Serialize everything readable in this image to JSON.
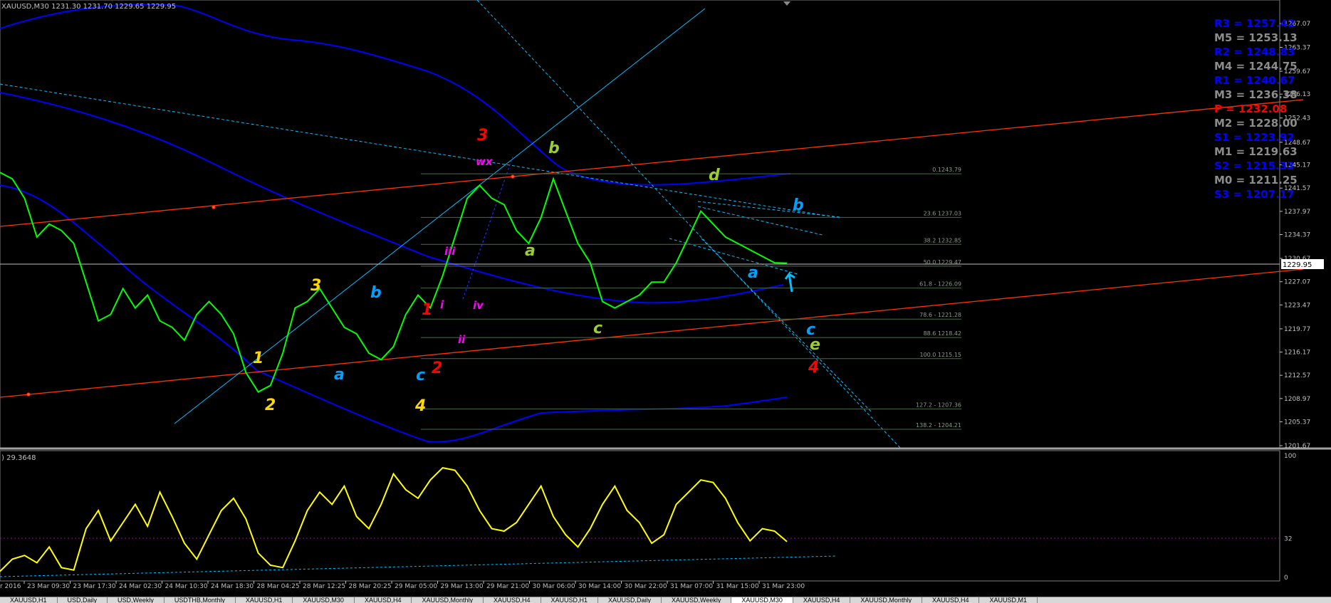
{
  "window": {
    "title": "XAUUSD,M30",
    "ohlc": "1231.30 1231.70 1229.65 1229.95"
  },
  "chart_data": {
    "type": "line",
    "title": "XAUUSD,M30 1231.30 1231.70 1229.65 1229.95",
    "price_scale": {
      "ticks": [
        "1267.07",
        "1263.37",
        "1259.67",
        "1256.13",
        "1252.43",
        "1248.67",
        "1245.17",
        "1241.57",
        "1237.97",
        "1234.37",
        "1230.67",
        "1227.07",
        "1223.47",
        "1219.77",
        "1216.17",
        "1212.57",
        "1208.97",
        "1205.37",
        "1201.67"
      ],
      "current_price": "1229.95"
    },
    "time_labels": [
      "23 Mar 09:30",
      "23 Mar 17:30",
      "24 Mar 02:30",
      "24 Mar 10:30",
      "24 Mar 18:30",
      "28 Mar 04:25",
      "28 Mar 12:25",
      "28 Mar 20:25",
      "29 Mar 05:00",
      "29 Mar 13:00",
      "29 Mar 21:00",
      "30 Mar 06:00",
      "30 Mar 14:00",
      "30 Mar 22:00",
      "31 Mar 07:00",
      "31 Mar 15:00",
      "31 Mar 23:00"
    ],
    "time_label_partial": "r 2016",
    "pivots": [
      {
        "label": "R3 = 1257.42",
        "color": "#0000ff"
      },
      {
        "label": "M5 = 1253.13",
        "color": "#8c8c8c"
      },
      {
        "label": "R2 = 1248.83",
        "color": "#0000ff"
      },
      {
        "label": "M4 = 1244.75",
        "color": "#8c8c8c"
      },
      {
        "label": "R1 = 1240.67",
        "color": "#0000ff"
      },
      {
        "label": "M3 = 1236.38",
        "color": "#8c8c8c"
      },
      {
        "label": "P = 1232.08",
        "color": "#ff0000"
      },
      {
        "label": "M2 = 1228.00",
        "color": "#8c8c8c"
      },
      {
        "label": "S1 = 1223.92",
        "color": "#0000ff"
      },
      {
        "label": "M1 = 1219.63",
        "color": "#8c8c8c"
      },
      {
        "label": "S2 = 1215.33",
        "color": "#0000ff"
      },
      {
        "label": "M0 = 1211.25",
        "color": "#8c8c8c"
      },
      {
        "label": "S3 = 1207.17",
        "color": "#0000ff"
      }
    ],
    "fibonacci": [
      {
        "label": "0.1243.79",
        "price": 1243.79
      },
      {
        "label": "23.6 1237.03",
        "price": 1237.03
      },
      {
        "label": "38.2 1232.85",
        "price": 1232.85
      },
      {
        "label": "50.0 1229.47",
        "price": 1229.47
      },
      {
        "label": "61.8 - 1226.09",
        "price": 1226.09
      },
      {
        "label": "78.6 - 1221.28",
        "price": 1221.28
      },
      {
        "label": "88.6 1218.42",
        "price": 1218.42
      },
      {
        "label": "100.0 1215.15",
        "price": 1215.15
      },
      {
        "label": "127.2 - 1207.36",
        "price": 1207.36
      },
      {
        "label": "138.2 - 1204.21",
        "price": 1204.21
      }
    ],
    "wave_labels": [
      {
        "t": "3",
        "color": "#ff0000"
      },
      {
        "t": "wx",
        "color": "#ff00ff"
      },
      {
        "t": "b",
        "color": "#9acd32"
      },
      {
        "t": "d",
        "color": "#9acd32"
      },
      {
        "t": "b",
        "color": "#00a0ff"
      },
      {
        "t": "iii",
        "color": "#ff00ff"
      },
      {
        "t": "a",
        "color": "#9acd32"
      },
      {
        "t": "a",
        "color": "#00a0ff"
      },
      {
        "t": "3",
        "color": "#ffd700"
      },
      {
        "t": "b",
        "color": "#00a0ff"
      },
      {
        "t": "1",
        "color": "#ff0000"
      },
      {
        "t": "i",
        "color": "#ff00ff"
      },
      {
        "t": "iv",
        "color": "#ff00ff"
      },
      {
        "t": "c",
        "color": "#9acd32"
      },
      {
        "t": "c",
        "color": "#00a0ff"
      },
      {
        "t": "ii",
        "color": "#ff00ff"
      },
      {
        "t": "e",
        "color": "#9acd32"
      },
      {
        "t": "1",
        "color": "#ffd700"
      },
      {
        "t": "a",
        "color": "#00a0ff"
      },
      {
        "t": "c",
        "color": "#00a0ff"
      },
      {
        "t": "2",
        "color": "#ff0000"
      },
      {
        "t": "4",
        "color": "#ff0000"
      },
      {
        "t": "2",
        "color": "#ffd700"
      },
      {
        "t": "4",
        "color": "#ffd700"
      }
    ],
    "price_series": [
      1244,
      1243,
      1240,
      1234,
      1236,
      1235,
      1233,
      1227,
      1221,
      1222,
      1226,
      1223,
      1225,
      1221,
      1220,
      1218,
      1222,
      1224,
      1222,
      1219,
      1213,
      1210,
      1211,
      1216,
      1223,
      1224,
      1226,
      1223,
      1220,
      1219,
      1216,
      1215,
      1217,
      1222,
      1225,
      1223,
      1228,
      1234,
      1240,
      1242,
      1240,
      1239,
      1235,
      1233,
      1237,
      1243,
      1238,
      1233,
      1230,
      1224,
      1223,
      1224,
      1225,
      1227,
      1227,
      1230,
      1234,
      1238,
      1236,
      1234,
      1233,
      1232,
      1231,
      1230,
      1229.95
    ],
    "price_series_color": "#00ff00",
    "indicator": {
      "label": ") 29.3648",
      "scale_ticks": [
        "100",
        "32",
        "0"
      ],
      "values": [
        5,
        15,
        18,
        12,
        25,
        8,
        6,
        40,
        55,
        30,
        45,
        60,
        42,
        70,
        50,
        28,
        15,
        35,
        55,
        65,
        48,
        20,
        10,
        8,
        30,
        55,
        70,
        60,
        75,
        50,
        40,
        60,
        85,
        72,
        65,
        80,
        90,
        88,
        75,
        55,
        40,
        38,
        45,
        60,
        75,
        50,
        35,
        25,
        40,
        60,
        75,
        55,
        45,
        28,
        35,
        60,
        70,
        80,
        78,
        65,
        45,
        30,
        40,
        38,
        29.36
      ],
      "color": "#ffff00"
    },
    "colors": {
      "background": "#000000",
      "grid_text": "#c0c0c0",
      "blue_bands": "#0000ff",
      "trend_red": "#ff3300",
      "trend_cyan": "#00bfff",
      "fib_lines": "#556b55"
    }
  },
  "tabs": [
    "XAUUSD,H1",
    "USD,Daily",
    "USD,Weekly",
    "USDTHB,Monthly",
    "XAUUSD,H1",
    "XAUUSD,M30",
    "XAUUSD,H4",
    "XAUUSD,Monthly",
    "XAUUSD,H4",
    "XAUUSD,H1",
    "XAUUSD,Daily",
    "XAUUSD,Weekly",
    "XAUUSD,M30",
    "XAUUSD,H4",
    "XAUUSD,Monthly",
    "XAUUSD,H4",
    "XAUUSD,M1"
  ],
  "active_tab_index": 12
}
